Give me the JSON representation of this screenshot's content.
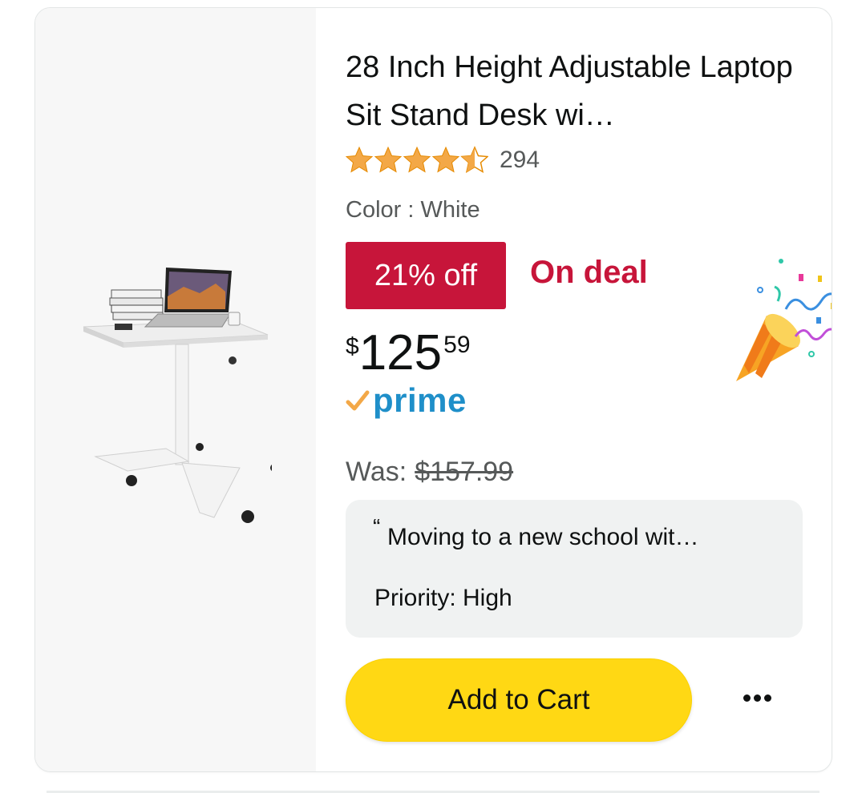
{
  "product": {
    "title": "28 Inch Height Adjustable Laptop Sit Stand Desk wi…",
    "rating": 4.5,
    "review_count": "294",
    "color_label": "Color : White",
    "deal_badge": "21% off",
    "deal_text": "On deal",
    "price": {
      "symbol": "$",
      "whole": "125",
      "fraction": "59"
    },
    "prime": "prime",
    "was_label": "Was:",
    "was_price": "$157.99",
    "note": {
      "quote_mark": "“",
      "message": "Moving to a new school wit…",
      "priority": "Priority: High"
    },
    "add_to_cart": "Add to Cart"
  },
  "icons": {
    "more": "more-options-icon",
    "celebration": "party-popper-icon",
    "prime_check": "prime-check-icon"
  },
  "colors": {
    "deal_red": "#c7153a",
    "cart_yellow": "#ffd814",
    "prime_blue": "#1f8fc9",
    "star_orange": "#f3a847"
  }
}
